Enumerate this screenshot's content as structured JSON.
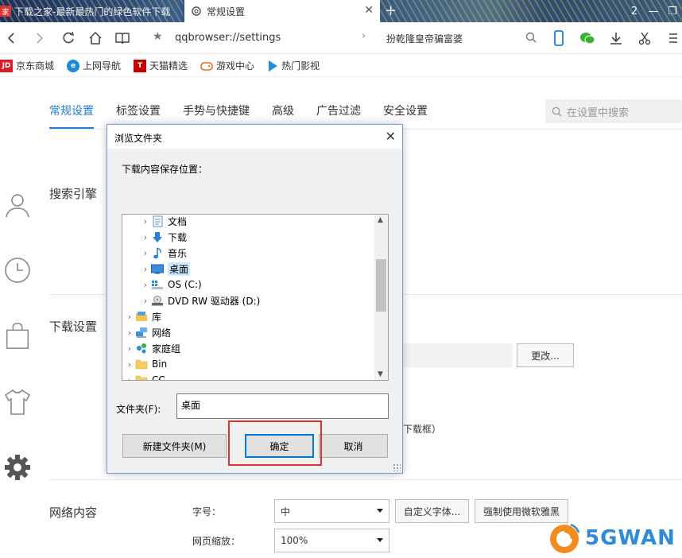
{
  "tabs": [
    {
      "title": "下载之家-最新最热门的绿色软件下载",
      "favicon_text": "家",
      "active": false
    },
    {
      "title": "常规设置",
      "active": true
    }
  ],
  "window_controls": {
    "counter": "2"
  },
  "address_bar": {
    "url": "qqbrowser://settings",
    "search_text": "扮乾隆皇帝骗富婆"
  },
  "bookmarks": [
    {
      "label": "京东商城",
      "icon_text": "JD",
      "color": "#d71e28"
    },
    {
      "label": "上网导航",
      "icon_text": "e",
      "color": "#1d8ad8"
    },
    {
      "label": "天猫精选",
      "icon_text": "T",
      "color": "#c40000"
    },
    {
      "label": "游戏中心",
      "icon_text": "",
      "color": "#f26b1d"
    },
    {
      "label": "热门影视",
      "icon_text": "",
      "color": "#1e8fe0"
    }
  ],
  "settings": {
    "tabs": [
      "常规设置",
      "标签设置",
      "手势与快捷键",
      "高级",
      "广告过滤",
      "安全设置"
    ],
    "active_tab": 0,
    "search_placeholder": "在设置中搜索",
    "sections": {
      "search_engine": "搜索引擎",
      "download": "下载设置",
      "network": "网络内容"
    },
    "download": {
      "change_button": "更改...",
      "fragment": "下载框）"
    },
    "network": {
      "font_size_label": "字号：",
      "font_size_value": "中",
      "custom_font_button": "自定义字体...",
      "force_yahei_button": "强制使用微软雅黑",
      "zoom_label": "网页缩放：",
      "zoom_value": "100%"
    }
  },
  "dialog": {
    "title": "浏览文件夹",
    "prompt": "下载内容保存位置：",
    "tree": [
      {
        "label": "文档",
        "level": 1,
        "icon": "document-icon"
      },
      {
        "label": "下载",
        "level": 1,
        "icon": "download-arrow-icon"
      },
      {
        "label": "音乐",
        "level": 1,
        "icon": "music-note-icon"
      },
      {
        "label": "桌面",
        "level": 1,
        "icon": "desktop-icon",
        "selected": true
      },
      {
        "label": "OS (C:)",
        "level": 1,
        "icon": "drive-icon"
      },
      {
        "label": "DVD RW 驱动器 (D:)",
        "level": 1,
        "icon": "dvd-drive-icon"
      },
      {
        "label": "库",
        "level": 0,
        "icon": "library-icon"
      },
      {
        "label": "网络",
        "level": 0,
        "icon": "network-icon"
      },
      {
        "label": "家庭组",
        "level": 0,
        "icon": "homegroup-icon"
      },
      {
        "label": "Bin",
        "level": 0,
        "icon": "folder-icon"
      },
      {
        "label": "CC",
        "level": 0,
        "icon": "folder-icon"
      }
    ],
    "folder_label": "文件夹(F):",
    "folder_value": "桌面",
    "new_folder_button": "新建文件夹(M)",
    "ok_button": "确定",
    "cancel_button": "取消"
  },
  "watermark": {
    "text": "5GWAN"
  }
}
